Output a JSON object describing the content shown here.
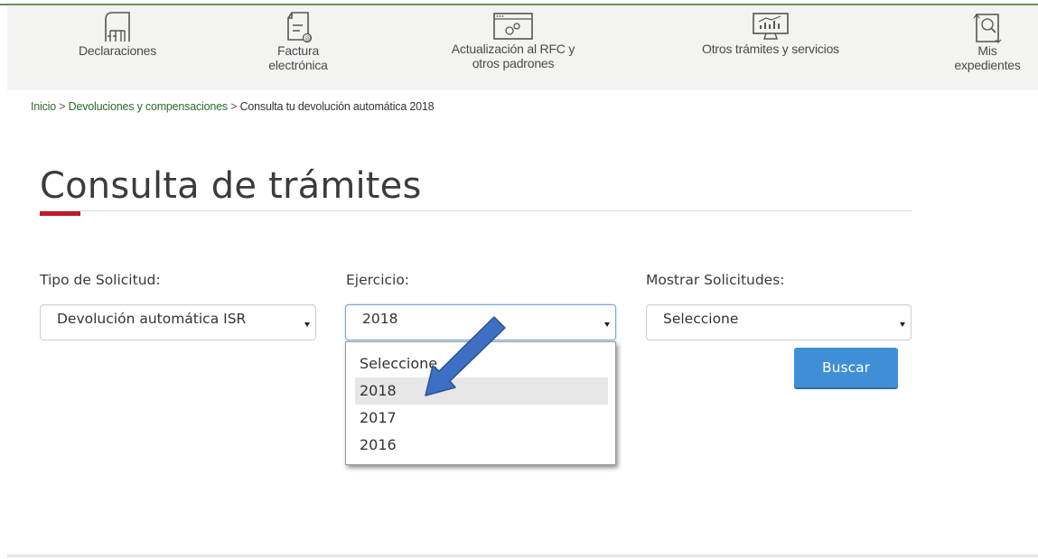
{
  "nav": {
    "items": [
      {
        "label": "Declaraciones",
        "icon": "declaraciones-icon"
      },
      {
        "label": "Factura",
        "label2": "electrónica",
        "icon": "factura-icon"
      },
      {
        "label": "Actualización al RFC y",
        "label2": "otros padrones",
        "icon": "rfc-gears-icon"
      },
      {
        "label": "Otros trámites y servicios",
        "icon": "monitor-chart-icon"
      },
      {
        "label": "Mis",
        "label2": "expedientes",
        "icon": "expedientes-icon"
      }
    ]
  },
  "breadcrumb": {
    "home": "Inicio",
    "separator": ">",
    "section": "Devoluciones y compensaciones",
    "current": "Consulta tu devolución automática 2018"
  },
  "page_title": "Consulta de trámites",
  "form": {
    "tipo": {
      "label": "Tipo de Solicitud:",
      "value": "Devolución automática ISR"
    },
    "ejercicio": {
      "label": "Ejercicio:",
      "value": "2018",
      "options": [
        "Seleccione",
        "2018",
        "2017",
        "2016"
      ],
      "highlighted": "2018"
    },
    "mostrar": {
      "label": "Mostrar Solicitudes:",
      "value": "Seleccione"
    },
    "buscar_label": "Buscar"
  },
  "colors": {
    "accent_red": "#c0182f",
    "button_blue": "#3f8fd6",
    "annotation_arrow": "#3f6fc4",
    "link_green": "#2e6b2f"
  }
}
